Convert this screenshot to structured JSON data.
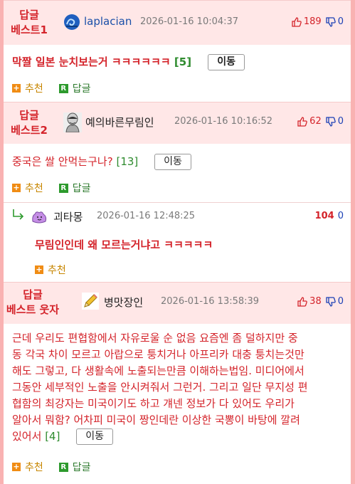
{
  "posts": [
    {
      "badge_line1": "답글",
      "badge_line2": "베스트1",
      "nick": "laplacian",
      "avatar": "swirl-blue-avatar",
      "date": "2026-01-16 10:04:37",
      "up": "189",
      "down": "0",
      "text": "막짤 일본 눈치보는거 ㅋㅋㅋㅋㅋㅋ",
      "count": "[5]",
      "move": "이동",
      "recommend": "추천",
      "reply": "답글"
    },
    {
      "badge_line1": "답글",
      "badge_line2": "베스트2",
      "nick": "예의바른무림인",
      "avatar": "martial-artist-avatar",
      "date": "2026-01-16 10:16:52",
      "up": "62",
      "down": "0",
      "text": "중국은 쌀 안먹는구나?",
      "count": "[13]",
      "move": "이동",
      "recommend": "추천",
      "reply": "답글"
    },
    {
      "nick": "괴타몽",
      "avatar": "ditto-avatar",
      "date": "2026-01-16 12:48:25",
      "up": "104",
      "down": "0",
      "text": "무림인인데 왜 모르는거냐고 ㅋㅋㅋㅋㅋ",
      "recommend": "추천"
    },
    {
      "badge_line1": "답글",
      "badge_line2": "베스트 웃자",
      "nick": "병맛장인",
      "avatar": "pencil-avatar",
      "date": "2026-01-16 13:58:39",
      "up": "38",
      "down": "0",
      "lines": [
        "근데 우리도 편협함에서 자유로울 순 없음 요즘엔 좀 덜하지만 중",
        "동 각국 차이 모르고 아랍으로 퉁치거나 아프리카 대충 퉁치는것만",
        "해도 그렇고, 다 생활속에 노출되는만큼 이해하는법임. 미디어에서",
        "그동안 세부적인 노출을 안시켜줘서 그런거. 그리고 일단 무지성 편",
        "협함의 최강자는 미국이기도 하고 걔넨 정보가 다 있어도 우리가",
        "알아서 뭐함? 어차피 미국이 짱인데란 이상한 국뽕이 바탕에 깔려",
        "있어서"
      ],
      "count": "[4]",
      "move": "이동",
      "recommend": "추천",
      "reply": "답글"
    }
  ],
  "colors": {
    "accent_red": "#d4232a",
    "count_green": "#2e8b2e",
    "thumb_blue": "#1a3fb5",
    "header_bg": "#ffe7e7",
    "outer_bg": "#f9b2b2"
  }
}
